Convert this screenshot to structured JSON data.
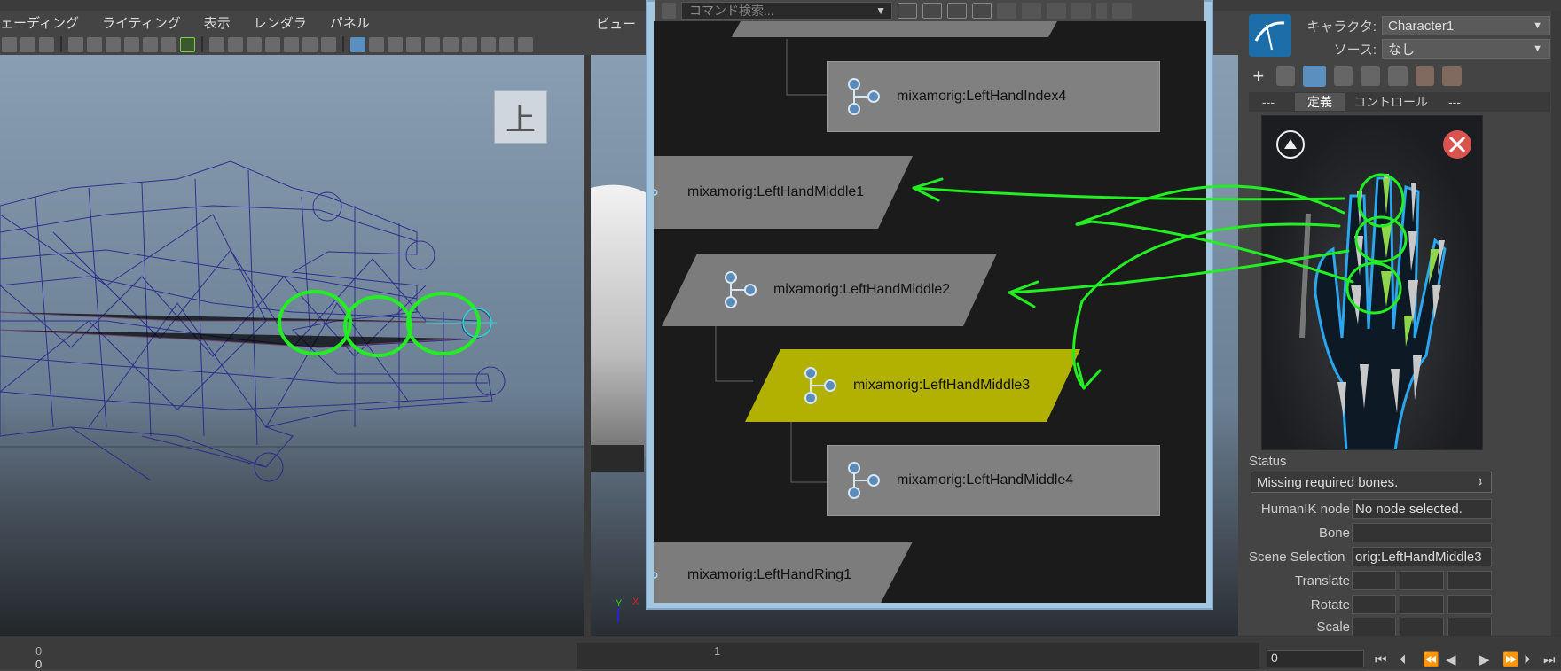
{
  "menubar": {
    "items": [
      "ェーディング",
      "ライティング",
      "表示",
      "レンダラ",
      "パネル"
    ]
  },
  "viewport_right": {
    "label": "ビュー"
  },
  "viewport_left": {
    "view_button_label": "上"
  },
  "node_editor": {
    "search_placeholder": "コマンド検索...",
    "nodes": [
      {
        "label": "mixamorig:LeftHandIndex4"
      },
      {
        "label": "mixamorig:LeftHandMiddle1"
      },
      {
        "label": "mixamorig:LeftHandMiddle2"
      },
      {
        "label": "mixamorig:LeftHandMiddle3"
      },
      {
        "label": "mixamorig:LeftHandMiddle4"
      },
      {
        "label": "mixamorig:LeftHandRing1"
      }
    ]
  },
  "humanik": {
    "character_label": "キャラクタ:",
    "character_value": "Character1",
    "source_label": "ソース:",
    "source_value": "なし",
    "tabs": [
      "---",
      "定義",
      "コントロール",
      "---"
    ],
    "status_title": "Status",
    "status_value": "Missing required bones.",
    "humanik_node_label": "HumanIK node",
    "humanik_node_value": "No node selected.",
    "bone_label": "Bone",
    "bone_value": "",
    "scene_selection_label": "Scene Selection",
    "scene_selection_value": "orig:LeftHandMiddle3",
    "translate_label": "Translate",
    "rotate_label": "Rotate",
    "scale_label": "Scale"
  },
  "timeline": {
    "tick_0": "0",
    "tick_0b": "0",
    "tick_1": "1",
    "current_frame": "0"
  },
  "colors": {
    "highlight_node": "#b2b000",
    "annotation": "#22ee22",
    "close_button": "#d9534f"
  }
}
